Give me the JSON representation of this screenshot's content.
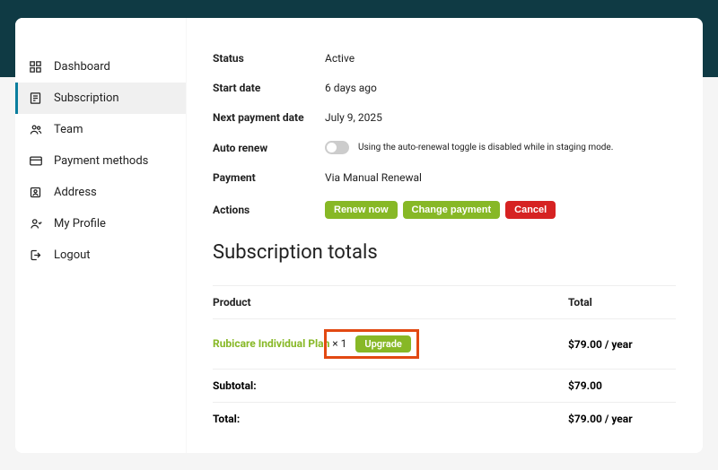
{
  "sidebar": {
    "items": [
      {
        "label": "Dashboard"
      },
      {
        "label": "Subscription"
      },
      {
        "label": "Team"
      },
      {
        "label": "Payment methods"
      },
      {
        "label": "Address"
      },
      {
        "label": "My Profile"
      },
      {
        "label": "Logout"
      }
    ]
  },
  "details": {
    "status_label": "Status",
    "status_value": "Active",
    "start_label": "Start date",
    "start_value": "6 days ago",
    "next_label": "Next payment date",
    "next_value": "July 9, 2025",
    "auto_label": "Auto renew",
    "auto_note": "Using the auto-renewal toggle is disabled while in staging mode.",
    "payment_label": "Payment",
    "payment_value": "Via Manual Renewal",
    "actions_label": "Actions",
    "renew_btn": "Renew now",
    "change_btn": "Change payment",
    "cancel_btn": "Cancel"
  },
  "totals": {
    "title": "Subscription totals",
    "product_header": "Product",
    "total_header": "Total",
    "product_name": "Rubicare Individual Plan",
    "product_qty": " × 1",
    "upgrade_label": "Upgrade",
    "line_total": "$79.00 / year",
    "subtotal_label": "Subtotal:",
    "subtotal_value": "$79.00",
    "total_label": "Total:",
    "total_value": "$79.00 / year"
  }
}
